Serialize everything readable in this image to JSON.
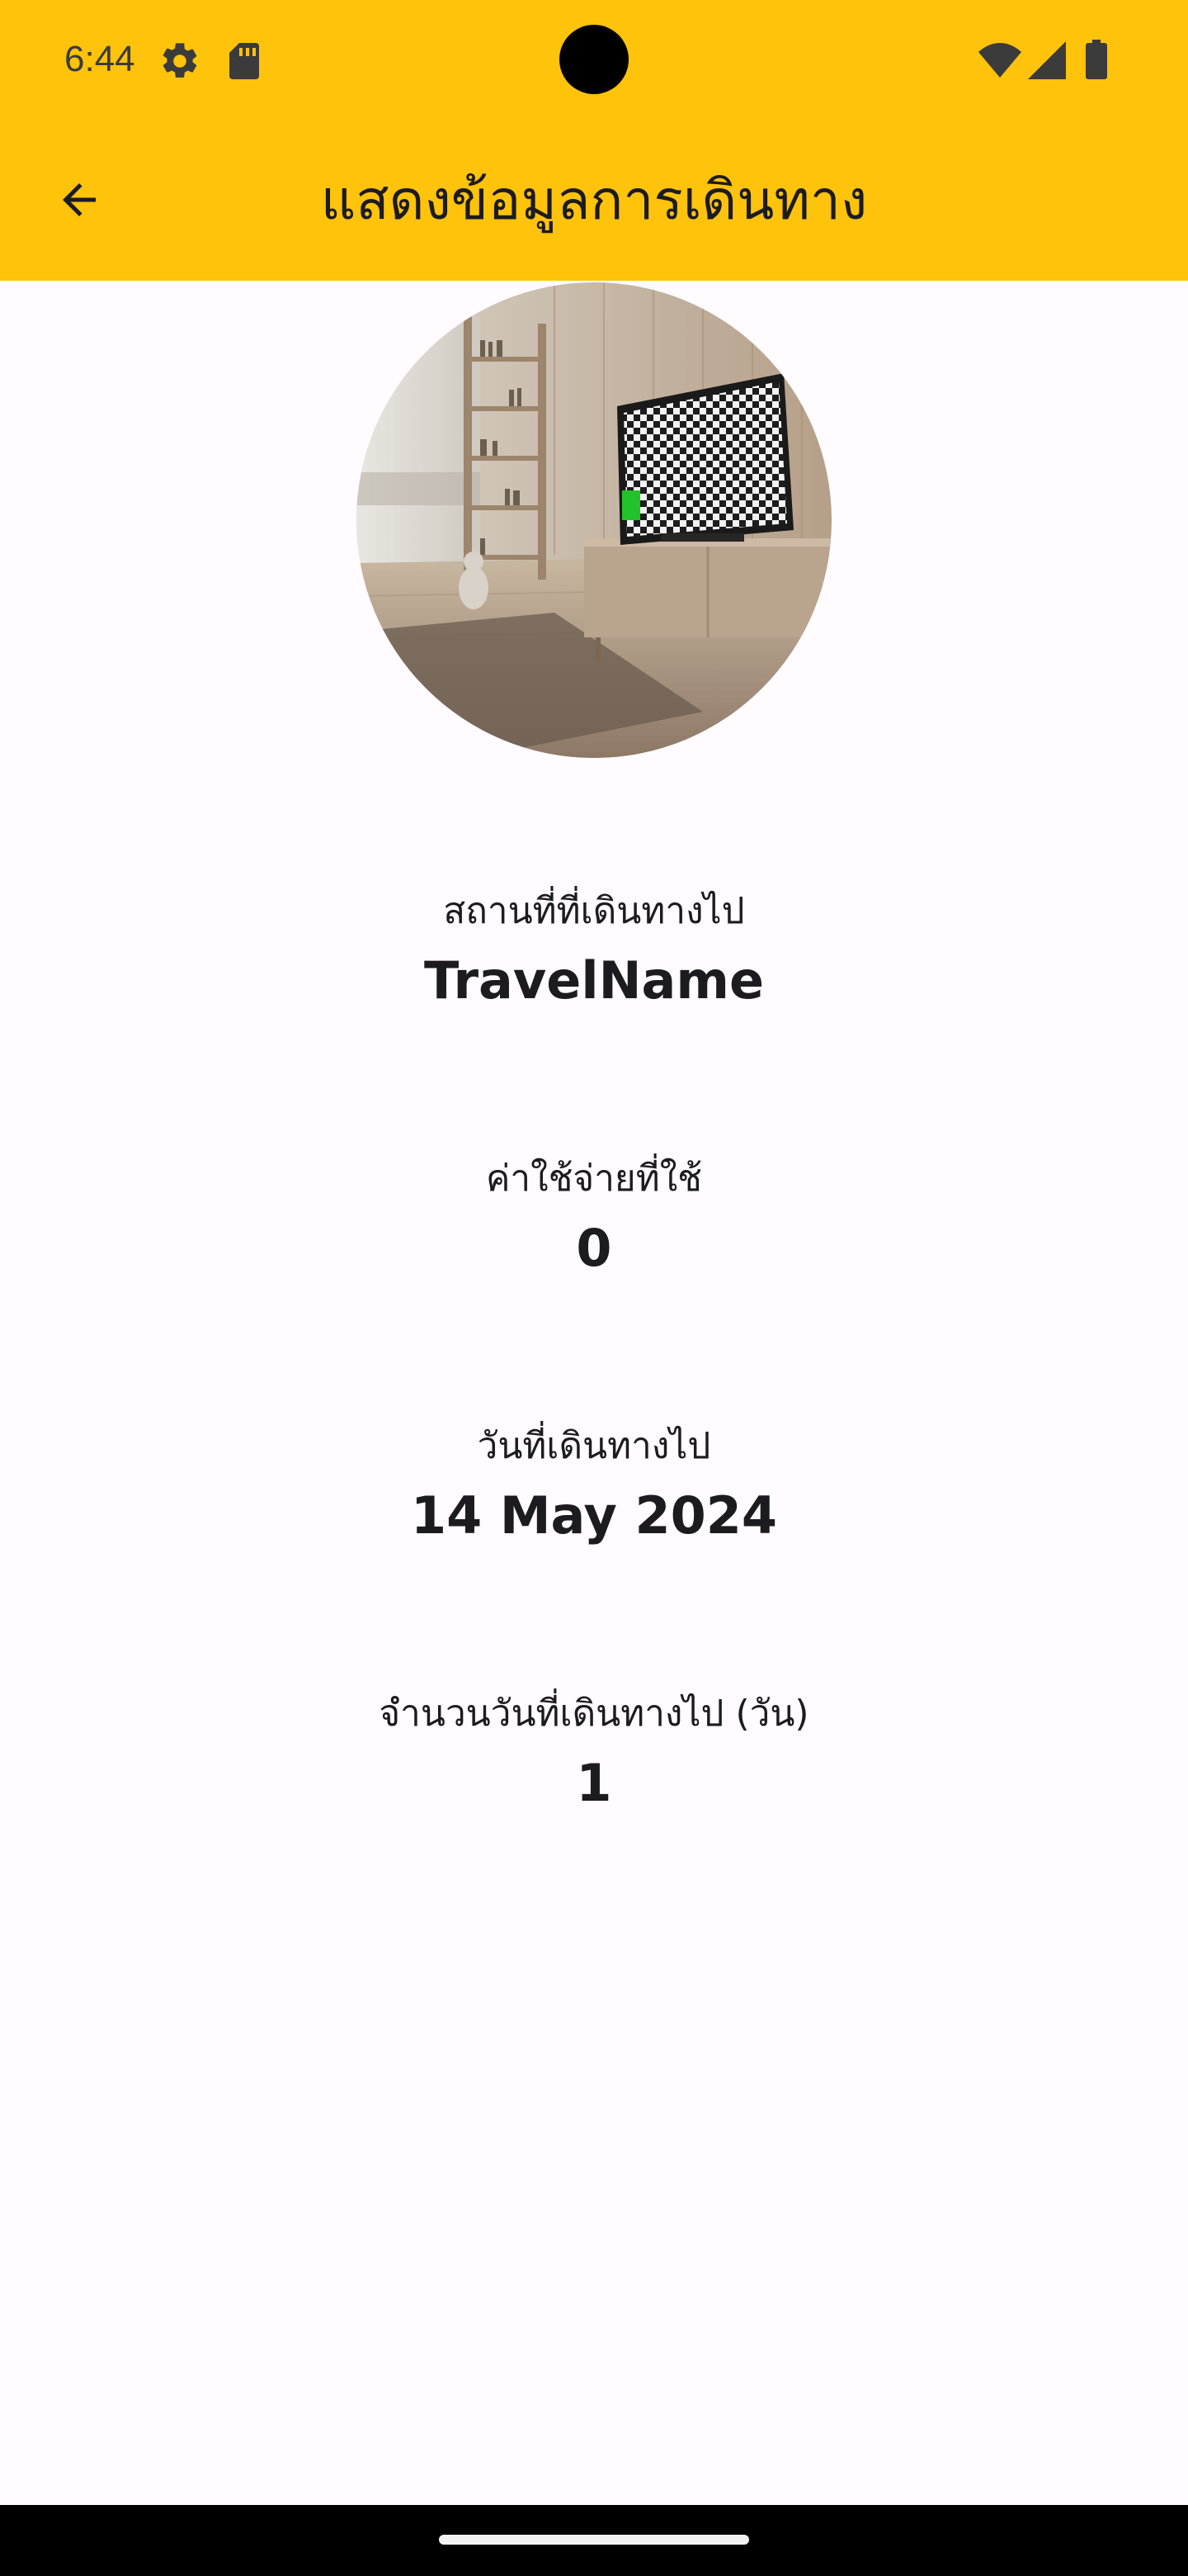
{
  "status_bar": {
    "time": "6:44",
    "icons": [
      "settings-gear-icon",
      "sd-card-icon",
      "wifi-icon",
      "cell-signal-icon",
      "battery-icon"
    ]
  },
  "app_bar": {
    "title": "แสดงข้อมูลการเดินทาง",
    "back_icon": "arrow-back-icon"
  },
  "avatar": {
    "description_icon": "living-room-photo"
  },
  "details": {
    "destination": {
      "label": "สถานที่ที่เดินทางไป",
      "value": "TravelName"
    },
    "expense": {
      "label": "ค่าใช้จ่ายที่ใช้",
      "value": "0"
    },
    "date": {
      "label": "วันที่เดินทางไป",
      "value": "14 May 2024"
    },
    "days": {
      "label": "จำนวนวันที่เดินทางไป (วัน)",
      "value": "1"
    }
  },
  "colors": {
    "accent": "#FFC30B",
    "background": "#FFFBFE",
    "text": "#1C1B1F"
  }
}
